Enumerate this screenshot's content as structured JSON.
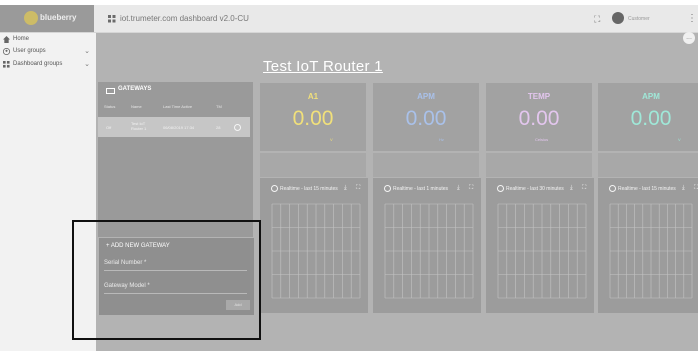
{
  "topbar": {
    "logo_text": "blueberry",
    "dashboard_title": "iot.trumeter.com dashboard v2.0-CU",
    "user_name": "Customer",
    "fullscreen_icon": "fullscreen-icon",
    "more_icon": "more-vertical-icon"
  },
  "sidebar": {
    "items": [
      {
        "label": "Home",
        "icon": "home-icon"
      },
      {
        "label": "User groups",
        "icon": "account-icon"
      },
      {
        "label": "Dashboard groups",
        "icon": "dashboard-icon"
      }
    ]
  },
  "main": {
    "router_title": "Test IoT Router 1",
    "more_label": "..."
  },
  "gateways": {
    "title": "GATEWAYS",
    "columns": [
      "Status",
      "Name",
      "Last Time Active",
      "TM"
    ],
    "rows": [
      {
        "status": "Off",
        "name": "Test IoT Router 1",
        "last_active": "06/08/2019 17:34",
        "tm": "28"
      }
    ]
  },
  "cards": [
    {
      "title": "A1",
      "value": "0.00",
      "unit": "V",
      "color": "#f1e07a"
    },
    {
      "title": "APM",
      "value": "0.00",
      "unit": "Hz",
      "color": "#a9c1ea"
    },
    {
      "title": "TEMP",
      "value": "0.00",
      "unit": "Celsius",
      "color": "#e3c6ee"
    },
    {
      "title": "APM",
      "value": "0.00",
      "unit": "V",
      "color": "#9fe8d8"
    }
  ],
  "charts": [
    {
      "label": "Realtime - last 15 minutes"
    },
    {
      "label": "Realtime - last 1 minutes"
    },
    {
      "label": "Realtime - last 30 minutes"
    },
    {
      "label": "Realtime - last 15 minutes"
    }
  ],
  "dialog": {
    "title": "+ ADD NEW GATEWAY",
    "serial_label": "Serial Number *",
    "model_label": "Gateway Model *",
    "add_label": "Add"
  }
}
